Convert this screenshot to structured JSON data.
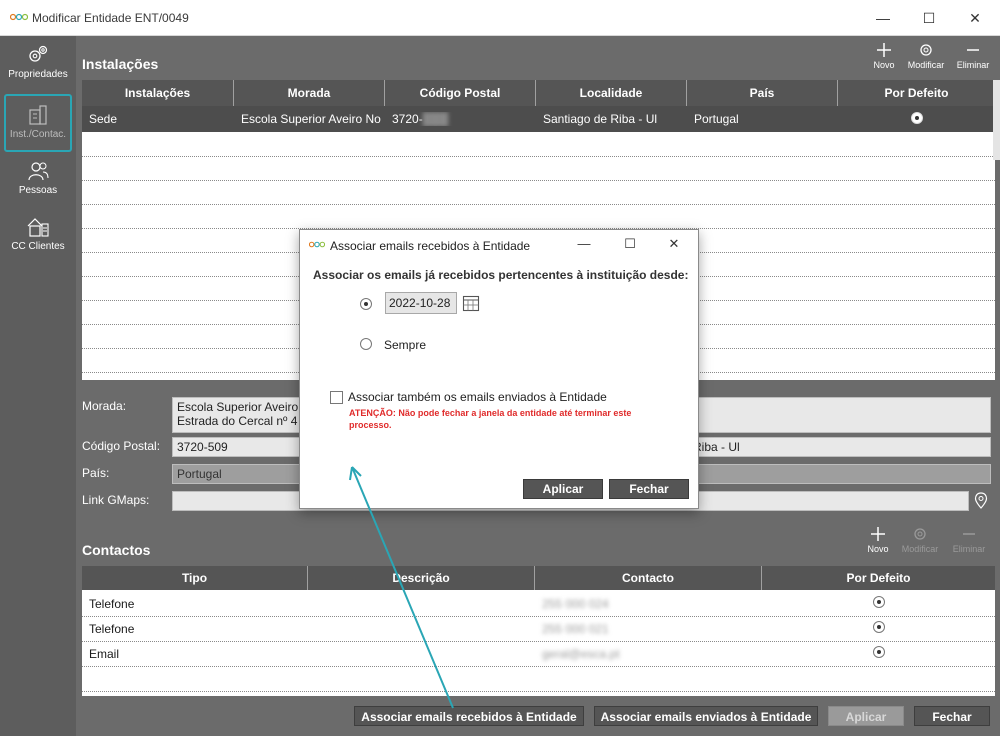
{
  "window": {
    "title": "Modificar Entidade ENT/0049",
    "minimize_glyph": "—",
    "maximize_glyph": "☐",
    "close_glyph": "✕"
  },
  "sidebar": {
    "items": [
      {
        "label": "Propriedades",
        "icon": "gears-icon"
      },
      {
        "label": "Inst./Contac.",
        "icon": "building-icon",
        "selected": true
      },
      {
        "label": "Pessoas",
        "icon": "people-icon"
      },
      {
        "label": "CC Clientes",
        "icon": "house-ledger-icon"
      }
    ]
  },
  "installations": {
    "title": "Instalações",
    "toolbar": {
      "new": "Novo",
      "modify": "Modificar",
      "delete": "Eliminar"
    },
    "columns": [
      "Instalações",
      "Morada",
      "Código Postal",
      "Localidade",
      "País",
      "Por Defeito"
    ],
    "rows": [
      {
        "instalacao": "Sede",
        "morada": "Escola Superior Aveiro No",
        "codigo_postal": "3720-",
        "localidade": "Santiago de Riba - Ul",
        "pais": "Portugal",
        "por_defeito": true
      }
    ]
  },
  "details": {
    "morada_label": "Morada:",
    "morada_line1": "Escola Superior Aveiro",
    "morada_line2": "Estrada do Cercal nº 4",
    "codigo_postal_label": "Código Postal:",
    "codigo_postal_value": "3720-509",
    "localidade_partial": "Riba - Ul",
    "pais_label": "País:",
    "pais_value": "Portugal",
    "gmaps_label": "Link GMaps:"
  },
  "contacts": {
    "title": "Contactos",
    "toolbar": {
      "new": "Novo",
      "modify": "Modificar",
      "delete": "Eliminar"
    },
    "columns": [
      "Tipo",
      "Descrição",
      "Contacto",
      "Por Defeito"
    ],
    "rows": [
      {
        "tipo": "Telefone",
        "descricao": "",
        "contacto": "255 000 024",
        "por_defeito": true
      },
      {
        "tipo": "Telefone",
        "descricao": "",
        "contacto": "255 000 021",
        "por_defeito": true
      },
      {
        "tipo": "Email",
        "descricao": "",
        "contacto": "geral@esca.pt",
        "por_defeito": true
      }
    ]
  },
  "bottom_buttons": {
    "assoc_received": "Associar emails recebidos à Entidade",
    "assoc_sent": "Associar emails enviados à Entidade",
    "apply": "Aplicar",
    "close": "Fechar"
  },
  "dialog": {
    "title": "Associar emails recebidos à Entidade",
    "heading": "Associar os emails já recebidos pertencentes à instituição desde:",
    "date_value": "2022-10-28",
    "always_label": "Sempre",
    "also_sent_label": "Associar também os emails enviados à Entidade",
    "warning": "ATENÇÃO: Não pode fechar a janela da entidade até terminar este processo.",
    "apply": "Aplicar",
    "close": "Fechar",
    "date_option_selected": true,
    "also_sent_checked": false
  },
  "colors": {
    "accent": "#2aa6b5",
    "sidebar_bg": "#5d5d5d",
    "main_bg": "#6b6b6b",
    "header_bg": "#555555",
    "warning": "#e02b2b"
  }
}
